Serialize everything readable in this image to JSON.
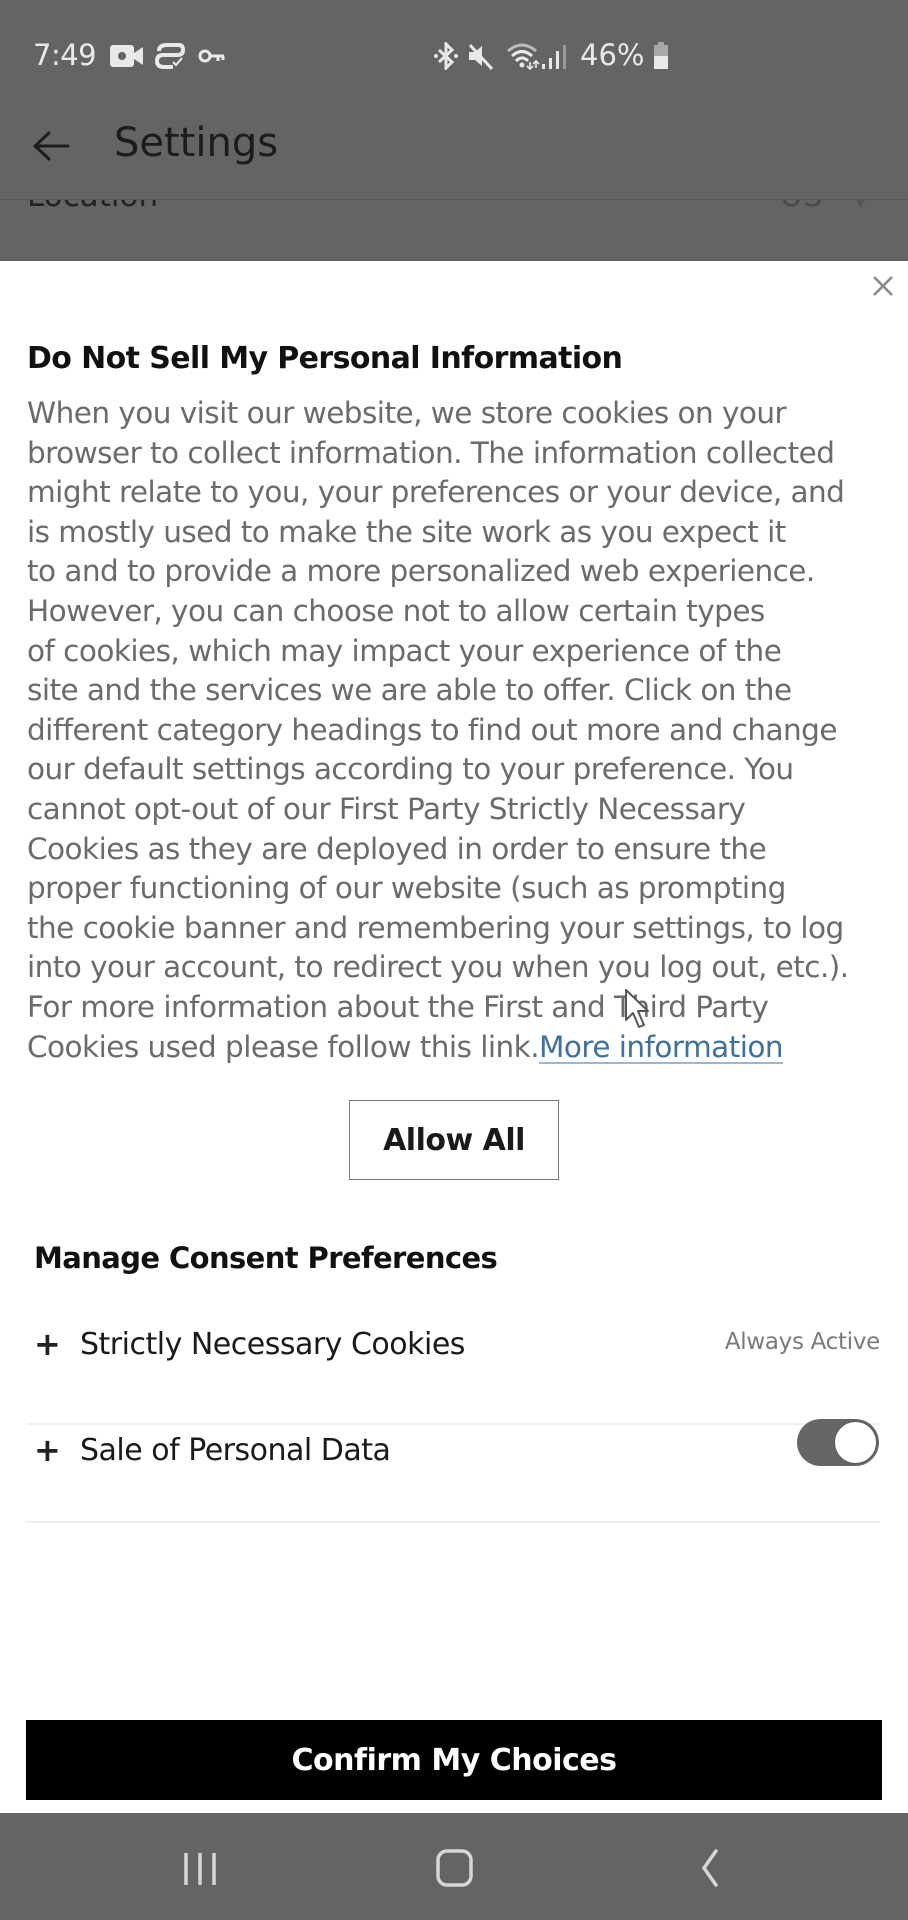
{
  "status_bar": {
    "time": "7:49",
    "left_icons": [
      "video-call-icon",
      "vpn-sync-icon",
      "key-icon"
    ],
    "right_icons": [
      "bluetooth-icon",
      "mute-icon",
      "wifi-icon",
      "signal-icon"
    ],
    "battery_percent": "46%",
    "battery_level": 0.46
  },
  "app_bar": {
    "back_icon": "arrow-left-icon",
    "title": "Settings"
  },
  "background_row": {
    "label": "Location",
    "value": "US"
  },
  "modal": {
    "close_icon": "close-icon",
    "title": "Do Not Sell My Personal Information",
    "body_lines": [
      "When you visit our website, we store cookies on your",
      "browser to collect information. The information collected",
      "might relate to you, your preferences or your device, and",
      "is mostly used to make the site work as you expect it",
      "to and to provide a more personalized web experience.",
      "However, you can choose not to allow certain types",
      "of cookies, which may impact your experience of the",
      "site and the services we are able to offer. Click on the",
      "different category headings to find out more and change",
      "our default settings according to your preference. You",
      "cannot opt-out of our First Party Strictly Necessary",
      "Cookies as they are deployed in order to ensure the",
      "proper functioning of our website (such as prompting",
      "the cookie banner and remembering your settings, to log",
      "into your account, to redirect you when you log out, etc.).",
      "For more information about the First and Third Party",
      "Cookies used please follow this link."
    ],
    "more_info_link": "More information",
    "link_color": "#3f719a",
    "allow_all_label": "Allow All",
    "consent_title": "Manage Consent Preferences",
    "preferences": [
      {
        "label": "Strictly Necessary Cookies",
        "status": "Always Active",
        "expand_icon": "plus-icon"
      },
      {
        "label": "Sale of Personal Data",
        "toggle_on": true,
        "expand_icon": "plus-icon"
      }
    ],
    "confirm_label": "Confirm My Choices"
  },
  "nav_bar": {
    "buttons": [
      "recent-apps-icon",
      "home-icon",
      "back-icon"
    ]
  },
  "colors": {
    "overlay_gray": "#646464",
    "body_text": "#6b6b6b",
    "toggle_track": "#666666",
    "confirm_bg": "#000000"
  }
}
